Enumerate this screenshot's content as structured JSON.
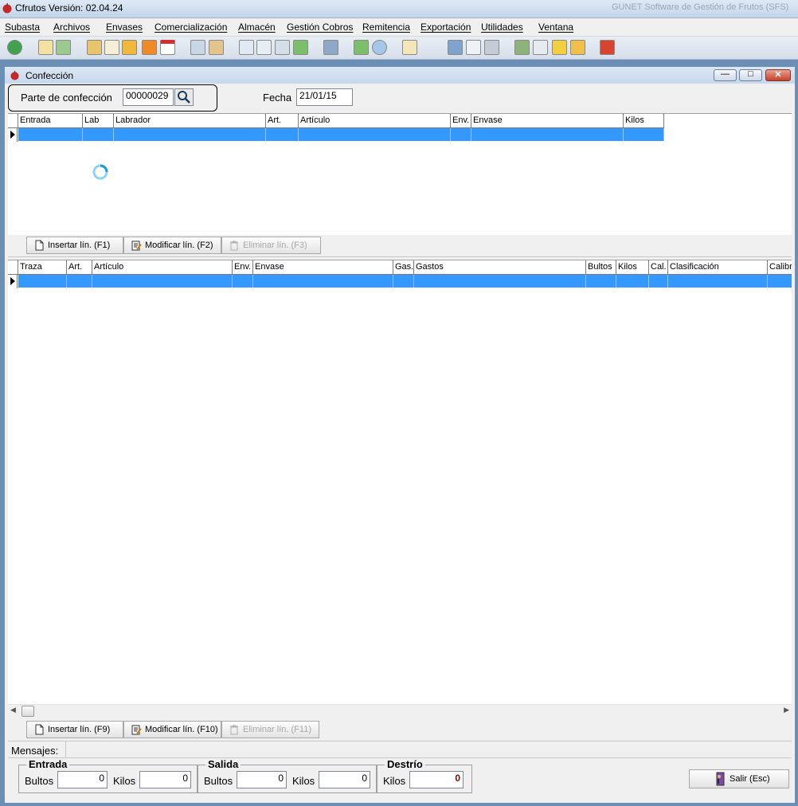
{
  "app": {
    "title": "Cfrutos Versión: 02.04.24",
    "right_title": "GUNET Software de Gestión de Frutos (SFS)"
  },
  "menu": [
    "Subasta",
    "Archivos",
    "Envases",
    "Comercialización",
    "Almacén",
    "Gestión Cobros",
    "Remitencia",
    "Exportación",
    "Utilidades",
    "Ventana"
  ],
  "toolbar_icons": [
    "refresh-icon",
    "edit-icon",
    "transfer-icon",
    "settings-icon",
    "invoice-icon",
    "jar-icon",
    "export-icon",
    "calendar-icon",
    "tools-icon",
    "tools2-icon",
    "document-icon",
    "document2-icon",
    "print-preview-icon",
    "money-icon",
    "truck-icon",
    "money2-icon",
    "clock-money-icon",
    "report-icon",
    "window-icon",
    "calculator-icon",
    "printer-icon",
    "users-icon",
    "search-people-icon",
    "key-icon",
    "lock-icon",
    "power-icon"
  ],
  "form": {
    "title": "Confección",
    "parte_label": "Parte de confección",
    "parte_value": "00000029",
    "fecha_label": "Fecha",
    "fecha_value": "21/01/15"
  },
  "grid1": {
    "columns": [
      "Entrada",
      "Lab",
      "Labrador",
      "Art.",
      "Artículo",
      "Env.",
      "Envase",
      "Kilos"
    ],
    "buttons": {
      "insert": "Insertar lín. (F1)",
      "modify": "Modificar lín. (F2)",
      "delete": "Eliminar lín. (F3)"
    }
  },
  "grid2": {
    "columns": [
      "Traza",
      "Art.",
      "Artículo",
      "Env.",
      "Envase",
      "Gas.",
      "Gastos",
      "Bultos",
      "Kilos",
      "Cal.",
      "Clasificación",
      "Calibr"
    ],
    "buttons": {
      "insert": "Insertar lín. (F9)",
      "modify": "Modificar lín. (F10)",
      "delete": "Eliminar lín. (F11)"
    }
  },
  "mensajes_label": "Mensajes:",
  "totals": {
    "entrada": {
      "legend": "Entrada",
      "bultos_label": "Bultos",
      "bultos": "0",
      "kilos_label": "Kilos",
      "kilos": "0"
    },
    "salida": {
      "legend": "Salida",
      "bultos_label": "Bultos",
      "bultos": "0",
      "kilos_label": "Kilos",
      "kilos": "0"
    },
    "destrio": {
      "legend": "Destrío",
      "kilos_label": "Kilos",
      "kilos": "0"
    }
  },
  "exit_button": "Salir (Esc)",
  "colors": {
    "selection": "#3399ff",
    "destrio_value": "#8b0000"
  }
}
